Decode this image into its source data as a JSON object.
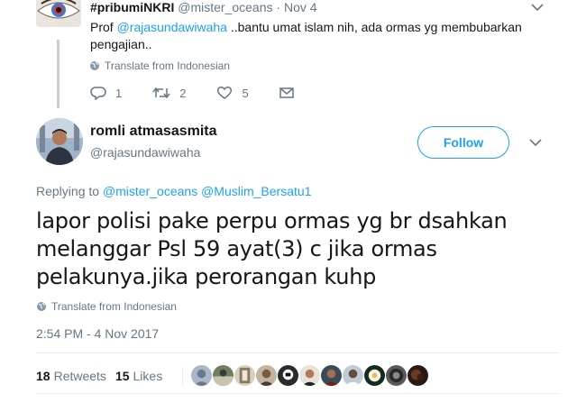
{
  "parent_tweet": {
    "display_name": "#pribumiNKRI",
    "handle": "@mister_oceans",
    "separator": "·",
    "date": "Nov 4",
    "text_prefix": "Prof ",
    "mention": "@rajasundawiwaha",
    "text_rest": " ..bantu umat islam nih, ada ormas yg membubarkan pengajian..",
    "translate_label": "Translate from Indonesian",
    "reply_count": "1",
    "retweet_count": "2",
    "like_count": "5"
  },
  "main_tweet": {
    "display_name": "romli atmasasmita",
    "handle": "@rajasundawiwaha",
    "follow_label": "Follow",
    "replying_prefix": "Replying to",
    "replying_to": [
      "@mister_oceans",
      "@Muslim_Bersatu1"
    ],
    "text": "lapor polisi pake perpu ormas yg br dsahkan melanggar Psl 59 ayat(3) c jika ormas pelakunya.jika perorangan kuhp",
    "translate_label": "Translate from Indonesian",
    "timestamp": "2:54 PM - 4 Nov 2017",
    "retweets_count": "18",
    "retweets_label": "Retweets",
    "likes_count": "15",
    "likes_label": "Likes"
  },
  "colors": {
    "accent": "#1da1f2",
    "muted": "#657786",
    "text": "#14171a",
    "border": "#e6ecf0"
  },
  "icons": [
    "eye-avatar",
    "chevron-down-icon",
    "globe-icon",
    "reply-icon",
    "retweet-icon",
    "heart-icon",
    "mail-icon",
    "liker-avatar"
  ]
}
